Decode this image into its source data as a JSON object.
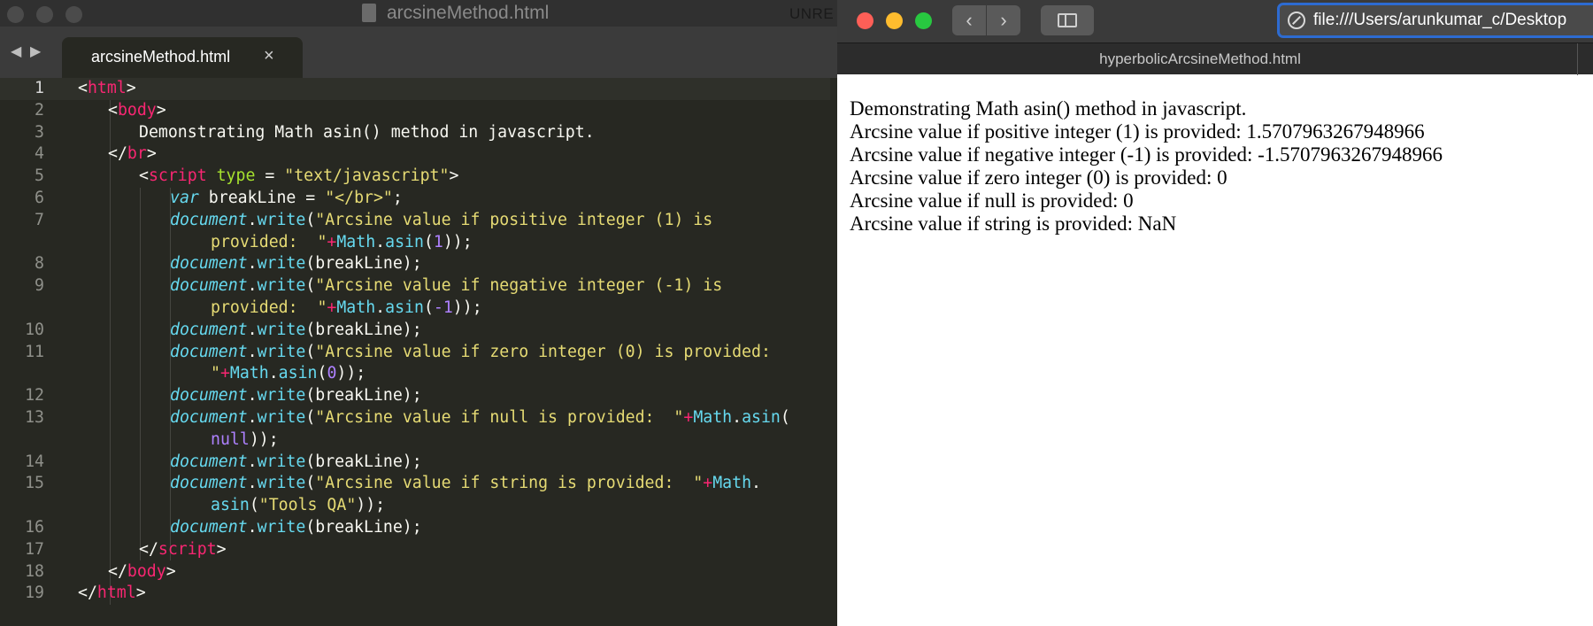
{
  "editor": {
    "window_title": "arcsineMethod.html",
    "unregistered_label": "UNRE",
    "tab_label": "arcsineMethod.html",
    "tab_close": "×",
    "nav_back": "◀",
    "nav_forward": "▶",
    "line_numbers": [
      "1",
      "2",
      "3",
      "4",
      "5",
      "6",
      "7",
      "",
      "8",
      "9",
      "",
      "10",
      "11",
      "",
      "12",
      "13",
      "",
      "14",
      "15",
      "",
      "16",
      "17",
      "18",
      "19"
    ],
    "code": {
      "l1": {
        "open": "<",
        "tag": "html",
        "close": ">"
      },
      "l2": {
        "open": "<",
        "tag": "body",
        "close": ">"
      },
      "l3": {
        "text": "Demonstrating Math asin() method in javascript."
      },
      "l4": {
        "open": "</",
        "tag": "br",
        "close": ">"
      },
      "l5": {
        "open": "<",
        "tag": "script",
        "attr": "type",
        "eq": " = ",
        "val": "\"text/javascript\"",
        "close": ">"
      },
      "l6": {
        "kw": "var",
        "name": " breakLine = ",
        "str": "\"</br>\"",
        "end": ";"
      },
      "l7": {
        "obj": "document",
        "dot": ".",
        "fn": "write",
        "paren": "(",
        "str": "\"Arcsine value if positive integer (1) is"
      },
      "l7b": {
        "str": "provided:  \"",
        "op": "+",
        "m": "Math",
        "dot": ".",
        "fn": "asin",
        "p1": "(",
        "num": "1",
        "p2": "));"
      },
      "l8": {
        "obj": "document",
        "dot": ".",
        "fn": "write",
        "rest": "(breakLine);"
      },
      "l9": {
        "obj": "document",
        "dot": ".",
        "fn": "write",
        "paren": "(",
        "str": "\"Arcsine value if negative integer (-1) is"
      },
      "l9b": {
        "str": "provided:  \"",
        "op": "+",
        "m": "Math",
        "dot": ".",
        "fn": "asin",
        "p1": "(",
        "num": "-1",
        "p2": "));"
      },
      "l10": {
        "obj": "document",
        "dot": ".",
        "fn": "write",
        "rest": "(breakLine);"
      },
      "l11": {
        "obj": "document",
        "dot": ".",
        "fn": "write",
        "paren": "(",
        "str": "\"Arcsine value if zero integer (0) is provided:"
      },
      "l11b": {
        "str": "\"",
        "op": "+",
        "m": "Math",
        "dot": ".",
        "fn": "asin",
        "p1": "(",
        "num": "0",
        "p2": "));"
      },
      "l12": {
        "obj": "document",
        "dot": ".",
        "fn": "write",
        "rest": "(breakLine);"
      },
      "l13": {
        "obj": "document",
        "dot": ".",
        "fn": "write",
        "paren": "(",
        "str": "\"Arcsine value if null is provided:  \"",
        "op": "+",
        "m": "Math",
        "dot2": ".",
        "fn2": "asin",
        "p1": "("
      },
      "l13b": {
        "num": "null",
        "p2": "));"
      },
      "l14": {
        "obj": "document",
        "dot": ".",
        "fn": "write",
        "rest": "(breakLine);"
      },
      "l15": {
        "obj": "document",
        "dot": ".",
        "fn": "write",
        "paren": "(",
        "str": "\"Arcsine value if string is provided:  \"",
        "op": "+",
        "m": "Math",
        "dot2": "."
      },
      "l15b": {
        "fn": "asin",
        "p1": "(",
        "str": "\"Tools QA\"",
        "p2": "));"
      },
      "l16": {
        "obj": "document",
        "dot": ".",
        "fn": "write",
        "rest": "(breakLine);"
      },
      "l17": {
        "open": "</",
        "tag": "script",
        "close": ">"
      },
      "l18": {
        "open": "</",
        "tag": "body",
        "close": ">"
      },
      "l19": {
        "open": "</",
        "tag": "html",
        "close": ">"
      }
    }
  },
  "browser": {
    "nav_back": "‹",
    "nav_forward": "›",
    "url": "file:///Users/arunkumar_c/Desktop",
    "tab_title": "hyperbolicArcsineMethod.html",
    "output_lines": [
      "Demonstrating Math asin() method in javascript.",
      "Arcsine value if positive integer (1) is provided: 1.5707963267948966",
      "Arcsine value if negative integer (-1) is provided: -1.5707963267948966",
      "Arcsine value if zero integer (0) is provided: 0",
      "Arcsine value if null is provided: 0",
      "Arcsine value if string is provided: NaN"
    ]
  },
  "colors": {
    "editor_bg": "#272822",
    "tag": "#f92672",
    "attribute": "#a6e22e",
    "string": "#e6db74",
    "keyword": "#66d9ef",
    "number": "#ae81ff",
    "close_red": "#fe5f57",
    "minimize_yellow": "#febc2e",
    "zoom_green": "#28c840",
    "url_focus_blue": "#2d6bd1"
  }
}
